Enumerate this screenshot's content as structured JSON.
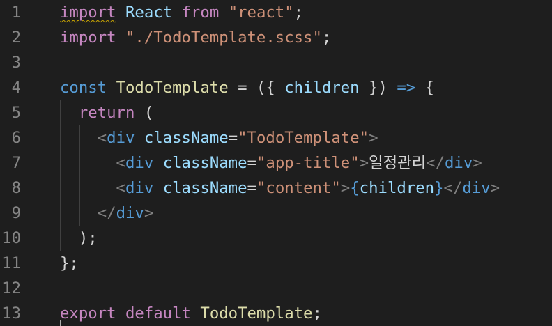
{
  "editor": {
    "lines": [
      {
        "number": "1",
        "tokens": [
          {
            "text": "import",
            "cls": "kw-ctrl squiggle"
          },
          {
            "text": " ",
            "cls": "plain"
          },
          {
            "text": "React",
            "cls": "var"
          },
          {
            "text": " ",
            "cls": "plain"
          },
          {
            "text": "from",
            "cls": "kw-ctrl"
          },
          {
            "text": " ",
            "cls": "plain"
          },
          {
            "text": "\"react\"",
            "cls": "str"
          },
          {
            "text": ";",
            "cls": "plain"
          }
        ]
      },
      {
        "number": "2",
        "tokens": [
          {
            "text": "import",
            "cls": "kw-ctrl"
          },
          {
            "text": " ",
            "cls": "plain"
          },
          {
            "text": "\"./TodoTemplate.scss\"",
            "cls": "str"
          },
          {
            "text": ";",
            "cls": "plain"
          }
        ]
      },
      {
        "number": "3",
        "tokens": []
      },
      {
        "number": "4",
        "tokens": [
          {
            "text": "const",
            "cls": "kw"
          },
          {
            "text": " ",
            "cls": "plain"
          },
          {
            "text": "TodoTemplate",
            "cls": "fn"
          },
          {
            "text": " = ({ ",
            "cls": "plain"
          },
          {
            "text": "children",
            "cls": "var"
          },
          {
            "text": " }) ",
            "cls": "plain"
          },
          {
            "text": "=>",
            "cls": "kw"
          },
          {
            "text": " {",
            "cls": "plain"
          }
        ]
      },
      {
        "number": "5",
        "tokens": [
          {
            "text": "  ",
            "cls": "plain"
          },
          {
            "text": "return",
            "cls": "kw-ctrl"
          },
          {
            "text": " (",
            "cls": "plain"
          }
        ]
      },
      {
        "number": "6",
        "tokens": [
          {
            "text": "    ",
            "cls": "plain"
          },
          {
            "text": "<",
            "cls": "tagp"
          },
          {
            "text": "div",
            "cls": "tag"
          },
          {
            "text": " ",
            "cls": "plain"
          },
          {
            "text": "className",
            "cls": "attr"
          },
          {
            "text": "=",
            "cls": "plain"
          },
          {
            "text": "\"TodoTemplate\"",
            "cls": "str"
          },
          {
            "text": ">",
            "cls": "tagp"
          }
        ]
      },
      {
        "number": "7",
        "tokens": [
          {
            "text": "      ",
            "cls": "plain"
          },
          {
            "text": "<",
            "cls": "tagp"
          },
          {
            "text": "div",
            "cls": "tag"
          },
          {
            "text": " ",
            "cls": "plain"
          },
          {
            "text": "className",
            "cls": "attr"
          },
          {
            "text": "=",
            "cls": "plain"
          },
          {
            "text": "\"app-title\"",
            "cls": "str"
          },
          {
            "text": ">",
            "cls": "tagp"
          },
          {
            "text": "일정관리",
            "cls": "plain"
          },
          {
            "text": "</",
            "cls": "tagp"
          },
          {
            "text": "div",
            "cls": "tag"
          },
          {
            "text": ">",
            "cls": "tagp"
          }
        ]
      },
      {
        "number": "8",
        "tokens": [
          {
            "text": "      ",
            "cls": "plain"
          },
          {
            "text": "<",
            "cls": "tagp"
          },
          {
            "text": "div",
            "cls": "tag"
          },
          {
            "text": " ",
            "cls": "plain"
          },
          {
            "text": "className",
            "cls": "attr"
          },
          {
            "text": "=",
            "cls": "plain"
          },
          {
            "text": "\"content\"",
            "cls": "str"
          },
          {
            "text": ">",
            "cls": "tagp"
          },
          {
            "text": "{",
            "cls": "kw"
          },
          {
            "text": "children",
            "cls": "var"
          },
          {
            "text": "}",
            "cls": "kw"
          },
          {
            "text": "</",
            "cls": "tagp"
          },
          {
            "text": "div",
            "cls": "tag"
          },
          {
            "text": ">",
            "cls": "tagp"
          }
        ]
      },
      {
        "number": "9",
        "tokens": [
          {
            "text": "    ",
            "cls": "plain"
          },
          {
            "text": "</",
            "cls": "tagp"
          },
          {
            "text": "div",
            "cls": "tag"
          },
          {
            "text": ">",
            "cls": "tagp"
          }
        ]
      },
      {
        "number": "10",
        "tokens": [
          {
            "text": "  );",
            "cls": "plain"
          }
        ]
      },
      {
        "number": "11",
        "tokens": [
          {
            "text": "};",
            "cls": "plain"
          }
        ]
      },
      {
        "number": "12",
        "tokens": []
      },
      {
        "number": "13",
        "tokens": [
          {
            "text": "export",
            "cls": "kw-ctrl"
          },
          {
            "text": " ",
            "cls": "plain"
          },
          {
            "text": "default",
            "cls": "kw-ctrl"
          },
          {
            "text": " ",
            "cls": "plain"
          },
          {
            "text": "TodoTemplate",
            "cls": "fn"
          },
          {
            "text": ";",
            "cls": "plain"
          }
        ]
      }
    ],
    "colors": {
      "background": "#1e1e1e",
      "line_number": "#858585",
      "keyword_control": "#c586c0",
      "keyword": "#569cd6",
      "function": "#dcdcaa",
      "variable": "#9cdcfe",
      "string": "#ce9178",
      "tag_punctuation": "#808080",
      "warning_squiggle": "#cca700"
    }
  }
}
